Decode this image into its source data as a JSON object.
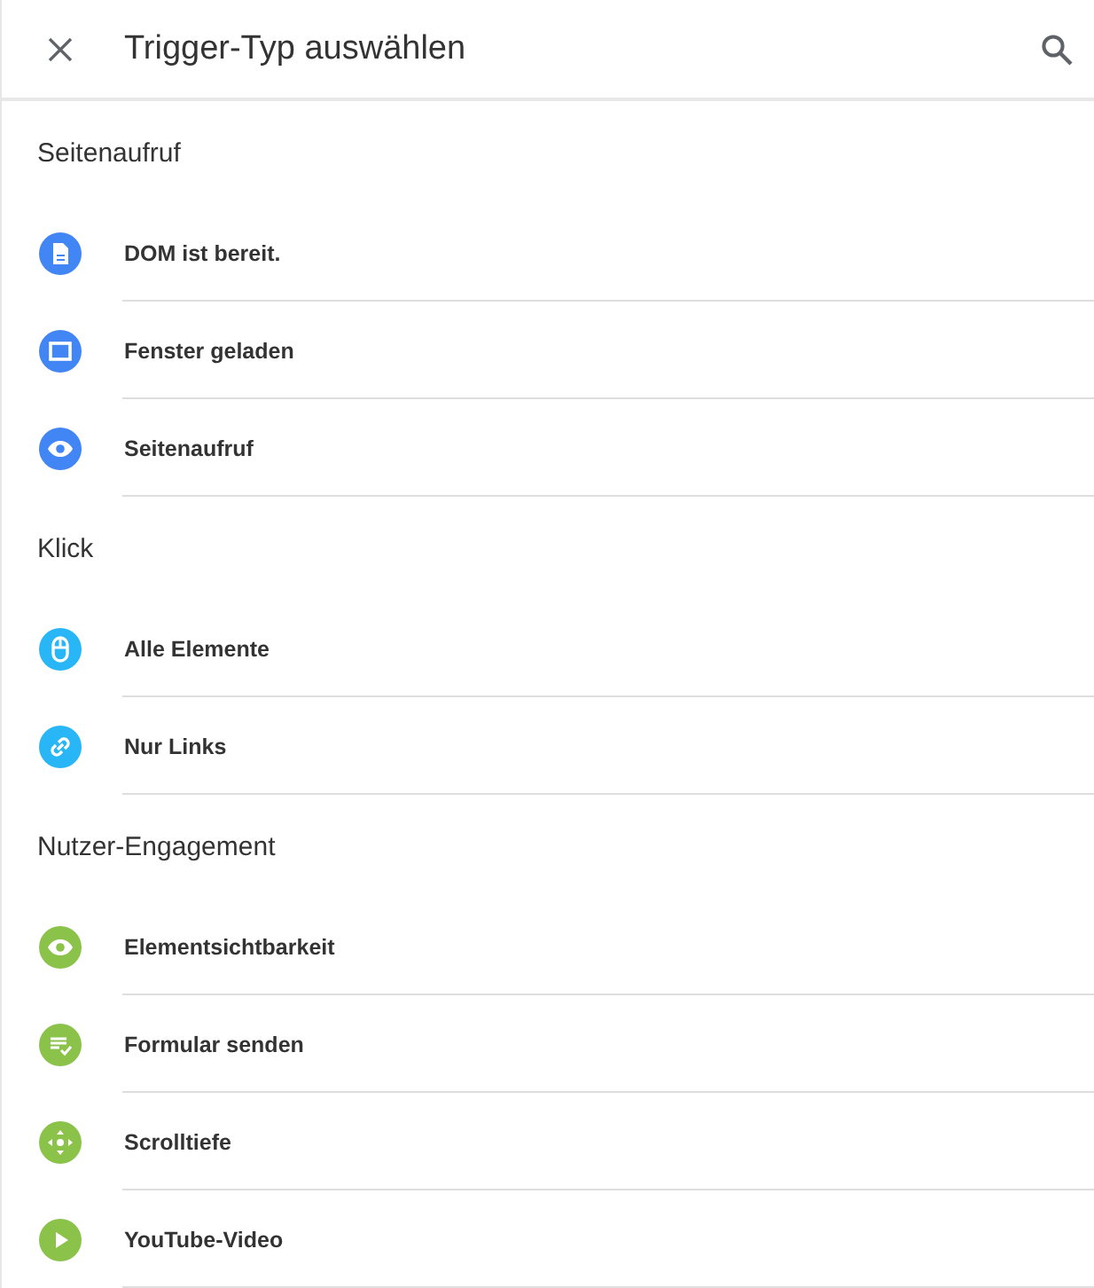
{
  "header": {
    "title": "Trigger-Typ auswählen"
  },
  "sections": [
    {
      "title": "Seitenaufruf",
      "items": [
        {
          "label": "DOM ist bereit.",
          "kind": "document",
          "color": "#4285f4"
        },
        {
          "label": "Fenster geladen",
          "kind": "window",
          "color": "#4285f4"
        },
        {
          "label": "Seitenaufruf",
          "kind": "eye",
          "color": "#4285f4"
        }
      ]
    },
    {
      "title": "Klick",
      "items": [
        {
          "label": "Alle Elemente",
          "kind": "mouse",
          "color": "#29b6f6"
        },
        {
          "label": "Nur Links",
          "kind": "link",
          "color": "#29b6f6"
        }
      ]
    },
    {
      "title": "Nutzer-Engagement",
      "items": [
        {
          "label": "Elementsichtbarkeit",
          "kind": "eye",
          "color": "#8bc34a"
        },
        {
          "label": "Formular senden",
          "kind": "form",
          "color": "#8bc34a"
        },
        {
          "label": "Scrolltiefe",
          "kind": "scroll",
          "color": "#8bc34a"
        },
        {
          "label": "YouTube-Video",
          "kind": "play",
          "color": "#8bc34a"
        }
      ]
    }
  ]
}
